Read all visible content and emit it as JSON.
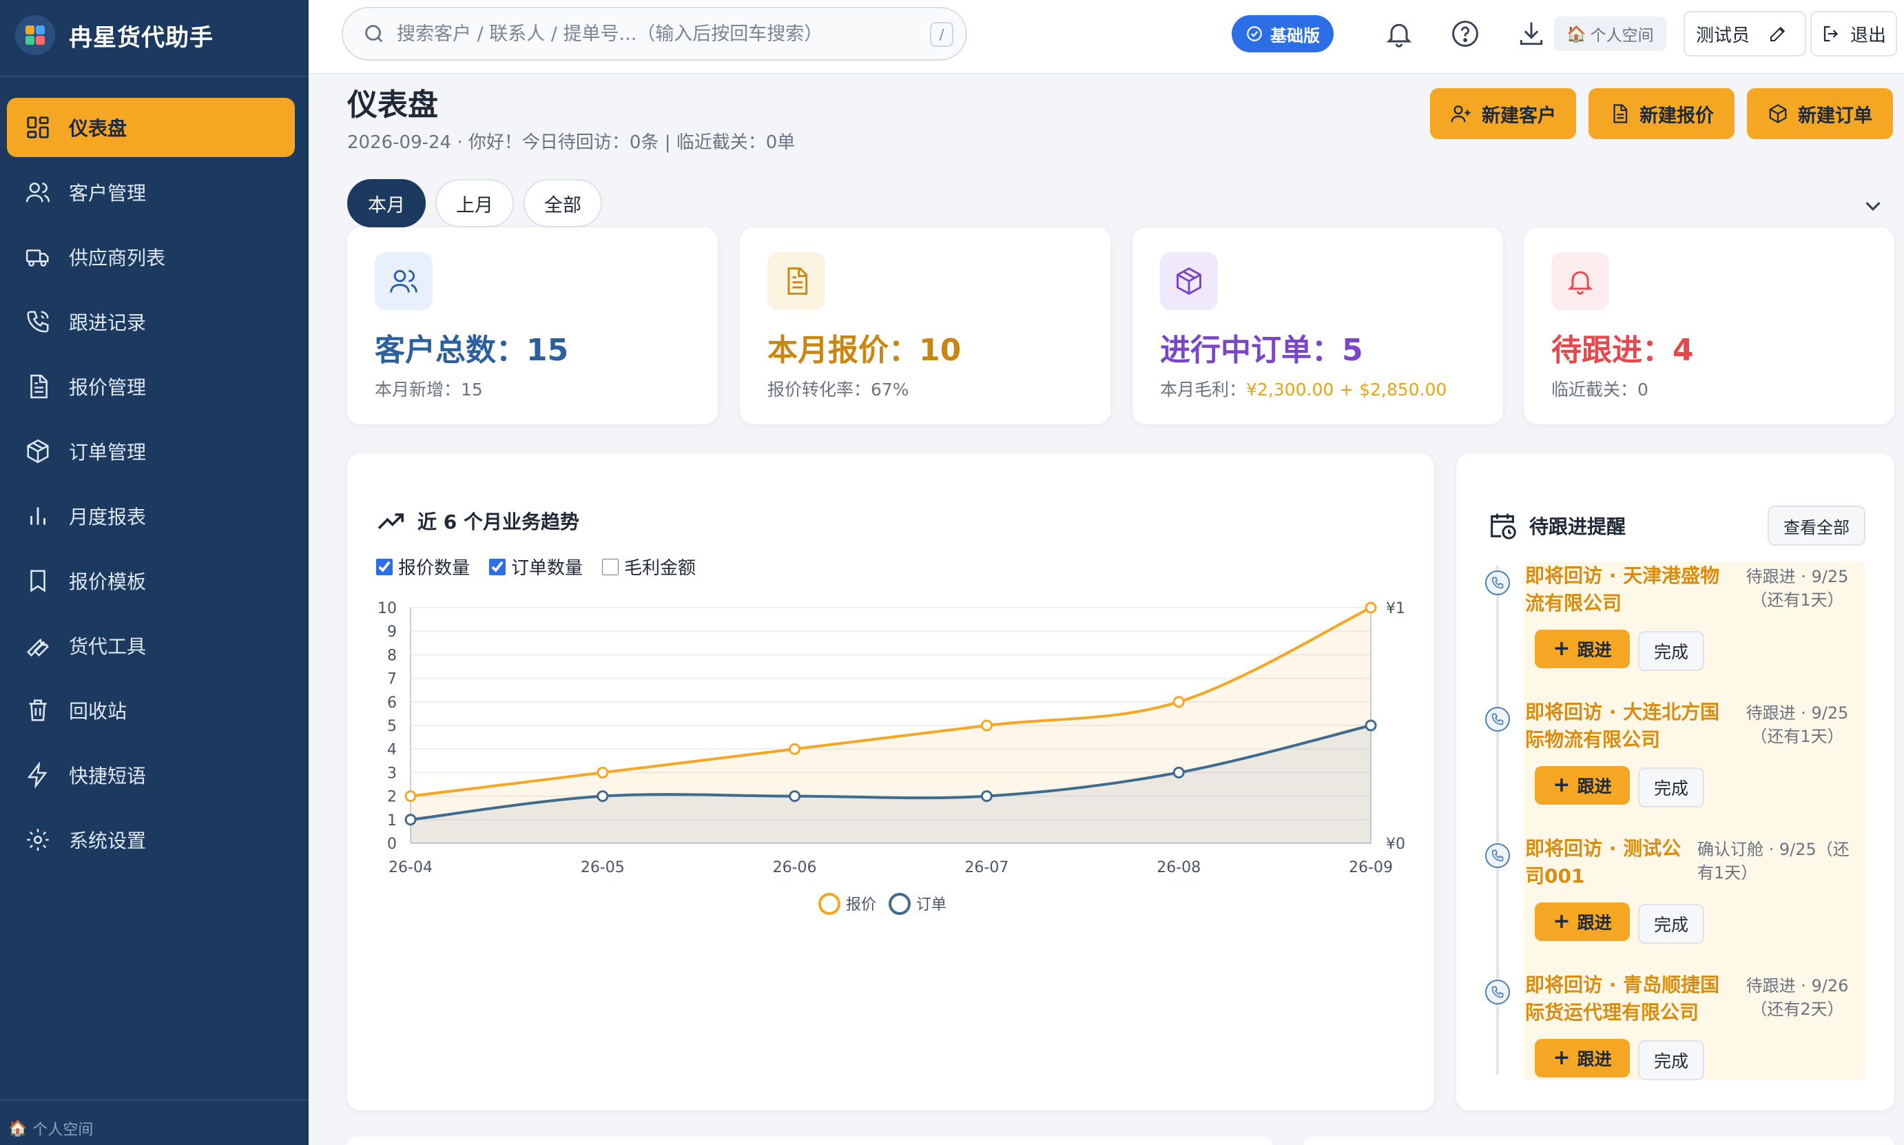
{
  "app": {
    "title": "冉星货代助手"
  },
  "sidebar": {
    "items": [
      {
        "label": "仪表盘",
        "icon": "dashboard-icon",
        "active": true
      },
      {
        "label": "客户管理",
        "icon": "users-icon"
      },
      {
        "label": "供应商列表",
        "icon": "truck-icon"
      },
      {
        "label": "跟进记录",
        "icon": "phone-icon"
      },
      {
        "label": "报价管理",
        "icon": "document-icon"
      },
      {
        "label": "订单管理",
        "icon": "box-icon"
      },
      {
        "label": "月度报表",
        "icon": "bar-chart-icon"
      },
      {
        "label": "报价模板",
        "icon": "bookmark-icon"
      },
      {
        "label": "货代工具",
        "icon": "wrench-icon"
      },
      {
        "label": "回收站",
        "icon": "trash-icon"
      },
      {
        "label": "快捷短语",
        "icon": "bolt-icon"
      },
      {
        "label": "系统设置",
        "icon": "gear-icon"
      }
    ],
    "footer": "个人空间"
  },
  "topbar": {
    "search_placeholder": "搜索客户 / 联系人 / 提单号...（输入后按回车搜索）",
    "search_shortcut": "/",
    "plan_badge": "基础版",
    "space_label": "个人空间",
    "user_name": "测试员",
    "logout_label": "退出"
  },
  "header": {
    "title": "仪表盘",
    "subtitle": "2026-09-24 · 你好！今日待回访：0条 | 临近截关：0单",
    "actions": [
      "新建客户",
      "新建报价",
      "新建订单"
    ]
  },
  "tabs": [
    "本月",
    "上月",
    "全部"
  ],
  "kpis": [
    {
      "value": "客户总数：15",
      "sub": "本月新增：15",
      "color": "#2b5f9e",
      "bg": "#e8f0fb"
    },
    {
      "value": "本月报价：10",
      "sub": "报价转化率：67%",
      "color": "#c98613",
      "bg": "#fdf3e1"
    },
    {
      "value": "进行中订单：5",
      "sub_prefix": "本月毛利：",
      "sub_highlight": "¥2,300.00 + $2,850.00",
      "color": "#7a45c8",
      "bg": "#efe9fb"
    },
    {
      "value": "待跟进：4",
      "sub": "临近截关：0",
      "color": "#e5484d",
      "bg": "#fdeced"
    }
  ],
  "chart": {
    "title": "近 6 个月业务趋势",
    "toggles": [
      {
        "label": "报价数量",
        "checked": true
      },
      {
        "label": "订单数量",
        "checked": true
      },
      {
        "label": "毛利金额",
        "checked": false
      }
    ],
    "right_axis_top": "¥1",
    "right_axis_bottom": "¥0"
  },
  "chart_data": {
    "type": "area",
    "x": [
      "26-04",
      "26-05",
      "26-06",
      "26-07",
      "26-08",
      "26-09"
    ],
    "series": [
      {
        "name": "报价",
        "values": [
          2,
          3,
          4,
          5,
          6,
          10
        ],
        "color": "#f5a623"
      },
      {
        "name": "订单",
        "values": [
          1,
          2,
          2,
          2,
          3,
          5
        ],
        "color": "#3f6b8f"
      }
    ],
    "ylim": [
      0,
      10
    ],
    "yticks": [
      0,
      1,
      2,
      3,
      4,
      5,
      6,
      7,
      8,
      9,
      10
    ],
    "grid": true,
    "legend": "bottom"
  },
  "reminders": {
    "title": "待跟进提醒",
    "view_all": "查看全部",
    "follow_label": "跟进",
    "done_label": "完成",
    "items": [
      {
        "name": "即将回访 · 天津港盛物流有限公司",
        "status": "待跟进 · 9/25（还有1天）"
      },
      {
        "name": "即将回访 · 大连北方国际物流有限公司",
        "status": "待跟进 · 9/25（还有1天）"
      },
      {
        "name": "即将回访 · 测试公司001",
        "status": "确认订舱 · 9/25（还有1天）"
      },
      {
        "name": "即将回访 · 青岛顺捷国际货运代理有限公司",
        "status": "待跟进 · 9/26（还有2天）"
      }
    ]
  }
}
